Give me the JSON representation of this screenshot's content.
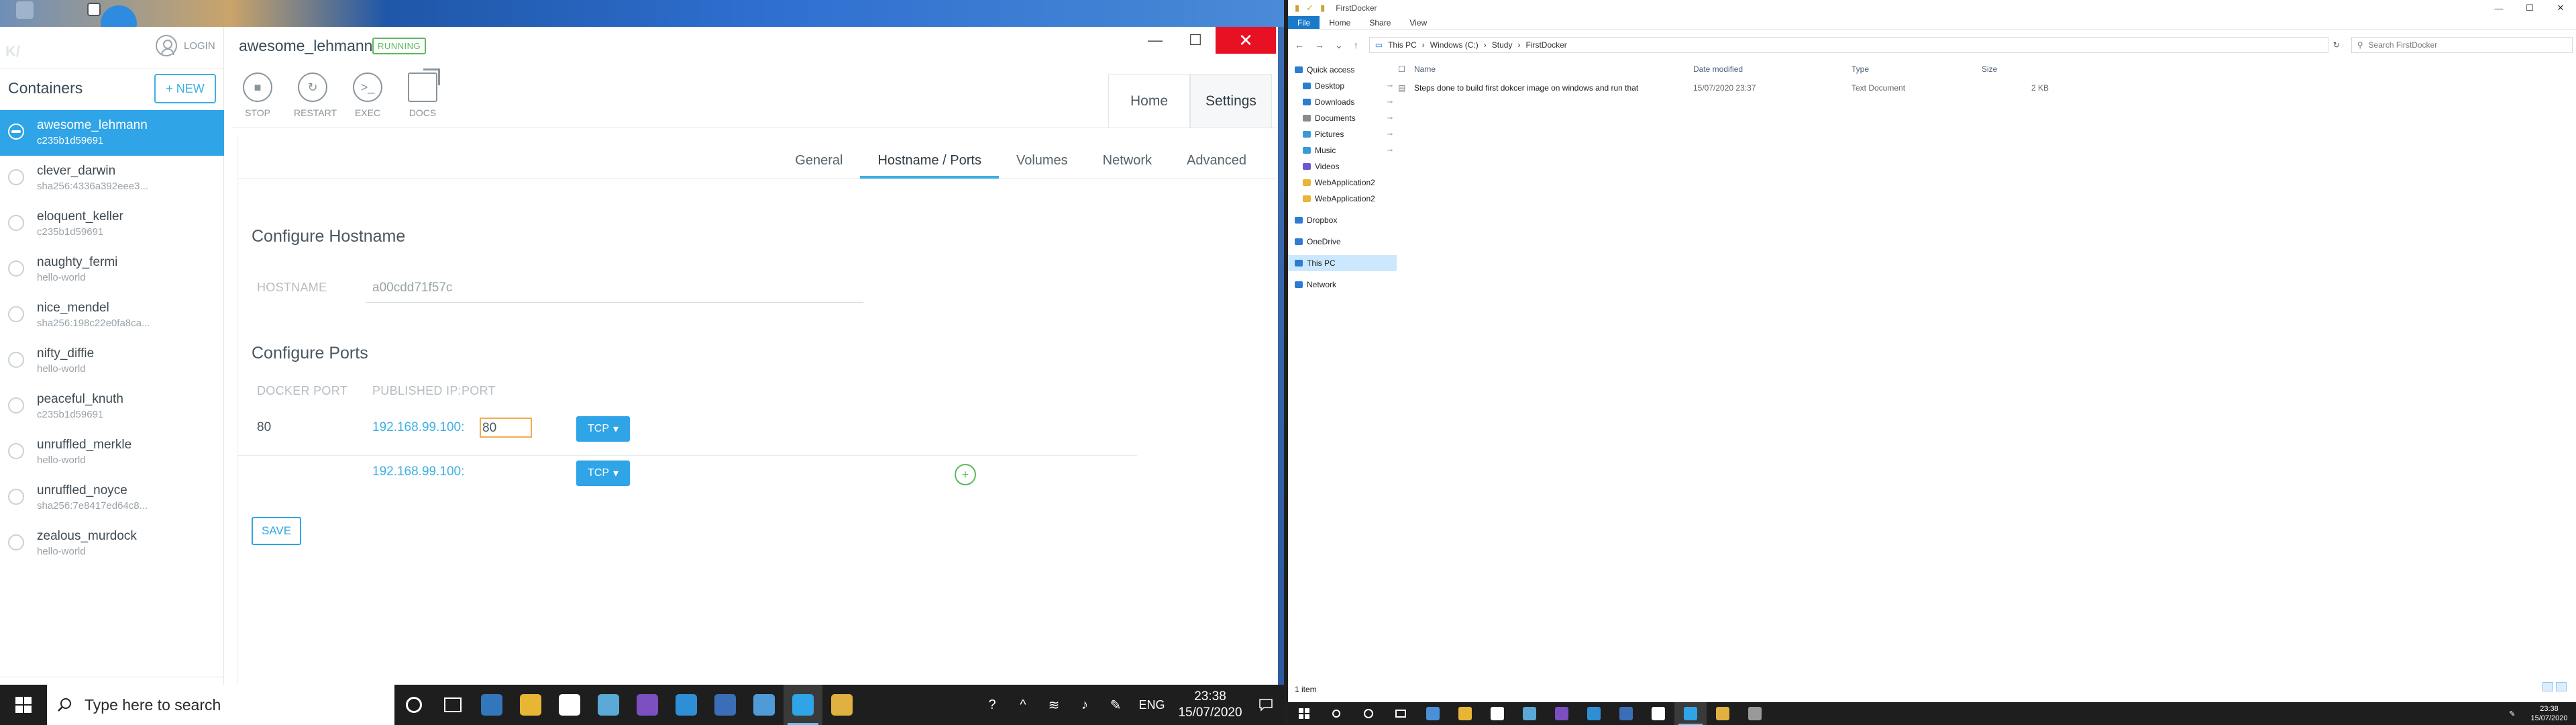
{
  "kitematic": {
    "login_label": "LOGIN",
    "containers_title": "Containers",
    "new_button": "+ NEW",
    "containers": [
      {
        "name": "awesome_lehmann",
        "image": "c235b1d59691",
        "active": true
      },
      {
        "name": "clever_darwin",
        "image": "sha256:4336a392eee3...",
        "active": false
      },
      {
        "name": "eloquent_keller",
        "image": "c235b1d59691",
        "active": false
      },
      {
        "name": "naughty_fermi",
        "image": "hello-world",
        "active": false
      },
      {
        "name": "nice_mendel",
        "image": "sha256:198c22e0fa8ca...",
        "active": false
      },
      {
        "name": "nifty_diffie",
        "image": "hello-world",
        "active": false
      },
      {
        "name": "peaceful_knuth",
        "image": "c235b1d59691",
        "active": false
      },
      {
        "name": "unruffled_merkle",
        "image": "hello-world",
        "active": false
      },
      {
        "name": "unruffled_noyce",
        "image": "sha256:7e8417ed64c8...",
        "active": false
      },
      {
        "name": "zealous_murdock",
        "image": "hello-world",
        "active": false
      }
    ],
    "container_name": "awesome_lehmann",
    "status": "RUNNING",
    "window_controls": {
      "minimize": "—",
      "maximize": "☐",
      "close": "✕"
    },
    "tools": [
      {
        "label": "STOP",
        "icon": "■"
      },
      {
        "label": "RESTART",
        "icon": "↻"
      },
      {
        "label": "EXEC",
        "icon": ">_"
      },
      {
        "label": "DOCS",
        "icon": ""
      }
    ],
    "nav_tabs": [
      "Home",
      "Settings"
    ],
    "active_nav_tab": "Settings",
    "sub_tabs": [
      "General",
      "Hostname / Ports",
      "Volumes",
      "Network",
      "Advanced"
    ],
    "active_sub_tab": "Hostname / Ports",
    "hostname_section": {
      "title": "Configure Hostname",
      "label": "HOSTNAME",
      "value": "a00cdd71f57c"
    },
    "ports_section": {
      "title": "Configure Ports",
      "col_docker_port": "DOCKER PORT",
      "col_published": "PUBLISHED IP:PORT",
      "rows": [
        {
          "docker_port": "80",
          "ip": "192.168.99.100:",
          "port_value": "80",
          "protocol": "TCP"
        },
        {
          "docker_port": "",
          "ip": "192.168.99.100:",
          "port_value": "",
          "protocol": "TCP"
        }
      ],
      "add_icon": "+",
      "save_label": "SAVE"
    }
  },
  "taskbar_left": {
    "search_placeholder": "Type here to search",
    "lang": "ENG",
    "time": "23:38",
    "date": "15/07/2020",
    "app_colors": [
      "#ffffff",
      "#ffffff",
      "#3277bc",
      "#e8b535",
      "#ffffff",
      "#5aa8d6",
      "#7b4fbf",
      "#2e8fd6",
      "#3a6fb7",
      "#4f9bd8",
      "#2fa4e7",
      "#e0b040"
    ]
  },
  "explorer": {
    "title": "FirstDocker",
    "window_controls": {
      "minimize": "—",
      "maximize": "☐",
      "close": "✕"
    },
    "ribbon_tabs": [
      "File",
      "Home",
      "Share",
      "View"
    ],
    "breadcrumb": [
      "This PC",
      "Windows (C:)",
      "Study",
      "FirstDocker"
    ],
    "search_placeholder": "Search FirstDocker",
    "nav_items": [
      {
        "label": "Quick access",
        "pinned": false,
        "color": "#2b7cd3",
        "indent": 0
      },
      {
        "label": "Desktop",
        "pinned": true,
        "color": "#2b7cd3",
        "indent": 1
      },
      {
        "label": "Downloads",
        "pinned": true,
        "color": "#2b7cd3",
        "indent": 1
      },
      {
        "label": "Documents",
        "pinned": true,
        "color": "#8a8a8a",
        "indent": 1
      },
      {
        "label": "Pictures",
        "pinned": true,
        "color": "#3a9ad9",
        "indent": 1
      },
      {
        "label": "Music",
        "pinned": true,
        "color": "#3a9ad9",
        "indent": 1
      },
      {
        "label": "Videos",
        "pinned": false,
        "color": "#6a5acd",
        "indent": 1
      },
      {
        "label": "WebApplication2",
        "pinned": false,
        "color": "#e8b535",
        "indent": 1
      },
      {
        "label": "WebApplication2",
        "pinned": false,
        "color": "#e8b535",
        "indent": 1
      },
      {
        "label": "",
        "pinned": false,
        "color": "",
        "indent": 0
      },
      {
        "label": "Dropbox",
        "pinned": false,
        "color": "#2f7bd8",
        "indent": 0
      },
      {
        "label": "",
        "pinned": false,
        "color": "",
        "indent": 0
      },
      {
        "label": "OneDrive",
        "pinned": false,
        "color": "#2f7bd8",
        "indent": 0
      },
      {
        "label": "",
        "pinned": false,
        "color": "",
        "indent": 0
      },
      {
        "label": "This PC",
        "pinned": false,
        "color": "#2b7cd3",
        "indent": 0,
        "selected": true
      },
      {
        "label": "",
        "pinned": false,
        "color": "",
        "indent": 0
      },
      {
        "label": "Network",
        "pinned": false,
        "color": "#2b7cd3",
        "indent": 0
      }
    ],
    "columns": [
      "Name",
      "Date modified",
      "Type",
      "Size"
    ],
    "files": [
      {
        "name": "Steps done to build first dokcer image on windows and run that",
        "date": "15/07/2020 23:37",
        "type": "Text Document",
        "size": "2 KB"
      }
    ],
    "status": "1 item"
  },
  "taskbar_right": {
    "time": "23:38",
    "date": "15/07/2020",
    "app_colors": [
      "#ffffff",
      "#ffffff",
      "#ffffff",
      "#4a90d9",
      "#e8b535",
      "#ffffff",
      "#5aa8d6",
      "#7b4fbf",
      "#2e8fd6",
      "#3a6fb7",
      "#ffffff",
      "#2fa4e7",
      "#e0b040",
      "#999999"
    ]
  }
}
